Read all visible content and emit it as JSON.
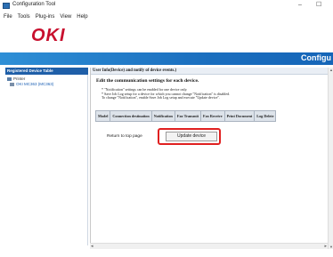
{
  "window": {
    "title": "Configuration Tool",
    "minimize_glyph": "–",
    "close_glyph": "☐"
  },
  "menubar": {
    "items": [
      "File",
      "Tools",
      "Plug-ins",
      "View",
      "Help"
    ]
  },
  "logo": {
    "text": "OKI",
    "color": "#c8102e"
  },
  "header": {
    "title": "Configu"
  },
  "left_panel": {
    "header": "Registered Device Table",
    "tree_root": "Printer",
    "tree_child": "OKI MC363 (MC363)"
  },
  "content": {
    "breadcrumb": "User Info(Device) and notify of device events.)",
    "section_title": "Edit the communication settings for each device.",
    "notes": [
      "* \"Notification\" settings can be enabled for one device only.",
      "* Save Job Log setup for a device for which you cannot change \"Notification\" is disabled.",
      "  To change \"Notification\", enable Save Job Log setup and execute \"Update device\"."
    ],
    "table_headers": [
      "Model",
      "Connection destination",
      "Notification",
      "Fax Transmit",
      "Fax Receive",
      "Print Document",
      "Log Delete"
    ],
    "return_link": "Return to top page",
    "update_button": "Update device"
  },
  "scrollbars": {
    "up_glyph": "▲",
    "down_glyph": "▼",
    "left_glyph": "◂",
    "right_glyph": "▸"
  },
  "colors": {
    "header_blue": "#1b6fbf",
    "panel_header": "#1f5fa8",
    "highlight": "#e02020"
  }
}
